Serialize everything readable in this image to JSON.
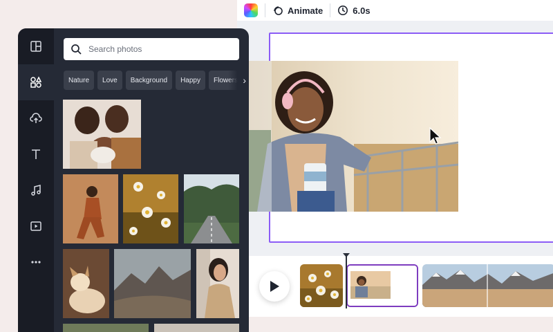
{
  "topbar": {
    "animate_label": "Animate",
    "duration_label": "6.0s"
  },
  "side_panel": {
    "search": {
      "placeholder": "Search photos",
      "value": ""
    },
    "tags": [
      "Nature",
      "Love",
      "Background",
      "Happy",
      "Flowers"
    ],
    "rail_icons": [
      "layout-icon",
      "elements-icon",
      "upload-cloud-icon",
      "text-icon",
      "music-icon",
      "video-icon",
      "more-icon"
    ],
    "photos": [
      "family-photo",
      "woman-orange-outfit-photo",
      "daisies-photo",
      "forest-road-photo",
      "dog-photo",
      "mountains-photo",
      "woman-portrait-photo"
    ]
  },
  "timeline": {
    "clips": [
      "daisies-clip",
      "woman-headphones-clip",
      "mountain-landscape-clip"
    ]
  },
  "colors": {
    "panel_bg": "#252a36",
    "rail_bg": "#191c25",
    "accent": "#8b5cf6",
    "selected_clip": "#7d3cbf"
  }
}
